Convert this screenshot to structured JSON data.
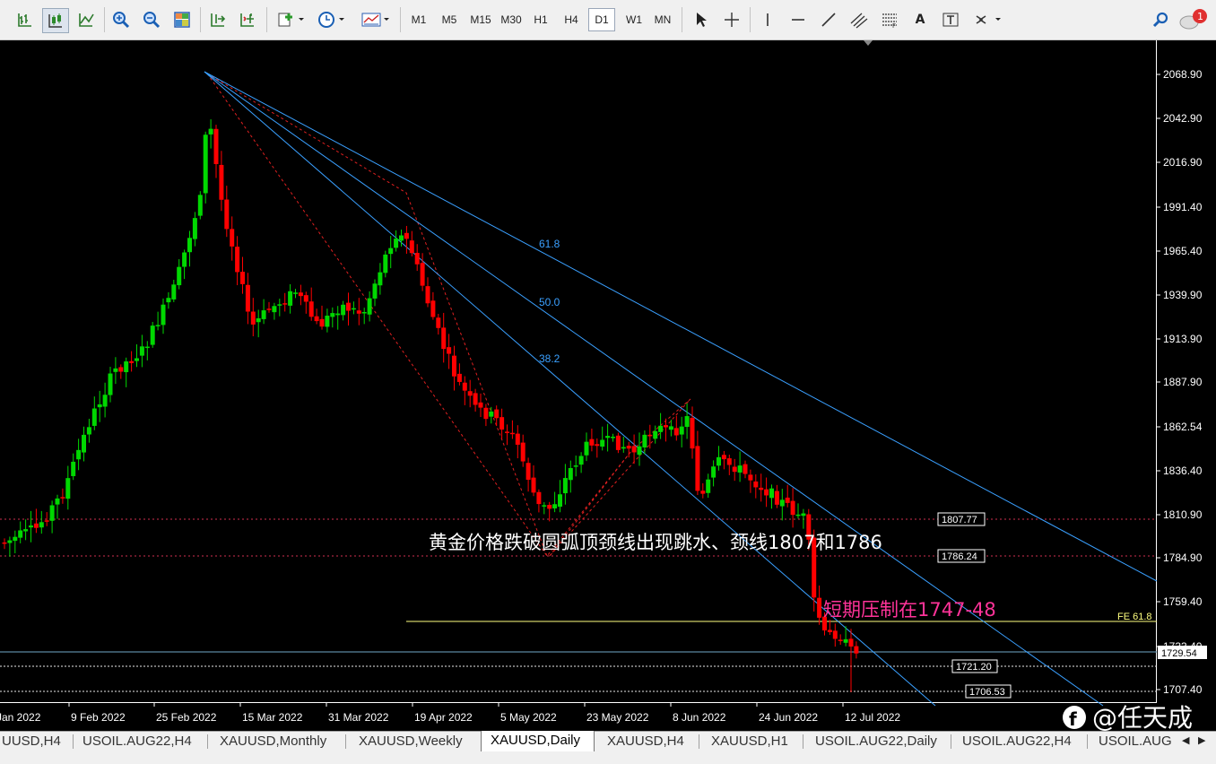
{
  "toolbar": {
    "timeframes": [
      "M1",
      "M5",
      "M15",
      "M30",
      "H1",
      "H4",
      "D1",
      "W1",
      "MN"
    ],
    "active_timeframe": "D1",
    "notification_count": "1",
    "text_tool_label": "A"
  },
  "chart": {
    "symbol": "XAUUSD",
    "period": "Daily",
    "price_axis": [
      "2068.90",
      "2042.90",
      "2016.90",
      "1991.40",
      "1965.40",
      "1939.90",
      "1913.90",
      "1887.90",
      "1862.54",
      "1836.40",
      "1810.90",
      "1784.90",
      "1759.40",
      "1733.40",
      "1707.40"
    ],
    "current_price": "1729.54",
    "date_axis": [
      "Jan 2022",
      "9 Feb 2022",
      "25 Feb 2022",
      "15 Mar 2022",
      "31 Mar 2022",
      "19 Apr 2022",
      "5 May 2022",
      "23 May 2022",
      "8 Jun 2022",
      "24 Jun 2022",
      "12 Jul 2022"
    ],
    "hline_labels": [
      "1807.77",
      "1786.24",
      "1721.20",
      "1706.53"
    ],
    "fe_label": "FE 61.8",
    "fib_fan_labels": [
      "61.8",
      "50.0",
      "38.2"
    ],
    "annotation_main": "黄金价格跌破圆弧顶颈线出现跳水、颈线1807和1786",
    "annotation_short_prefix": "短期压制在",
    "annotation_short_value": "1747-48",
    "watermark": "@任天成",
    "colors": {
      "bull": "#00d800",
      "bear": "#ff0000",
      "fan": "#1e90ff",
      "fe": "#ffff80",
      "annotation_pink": "#ff3399",
      "background": "#000000"
    }
  },
  "tabs": [
    "UUSD,H4",
    "USOIL.AUG22,H4",
    "XAUUSD,Monthly",
    "XAUUSD,Weekly",
    "XAUUSD,Daily",
    "XAUUSD,H4",
    "XAUUSD,H1",
    "USOIL.AUG22,Daily",
    "USOIL.AUG22,H4",
    "USOIL.AUG"
  ],
  "active_tab": "XAUUSD,Daily"
}
